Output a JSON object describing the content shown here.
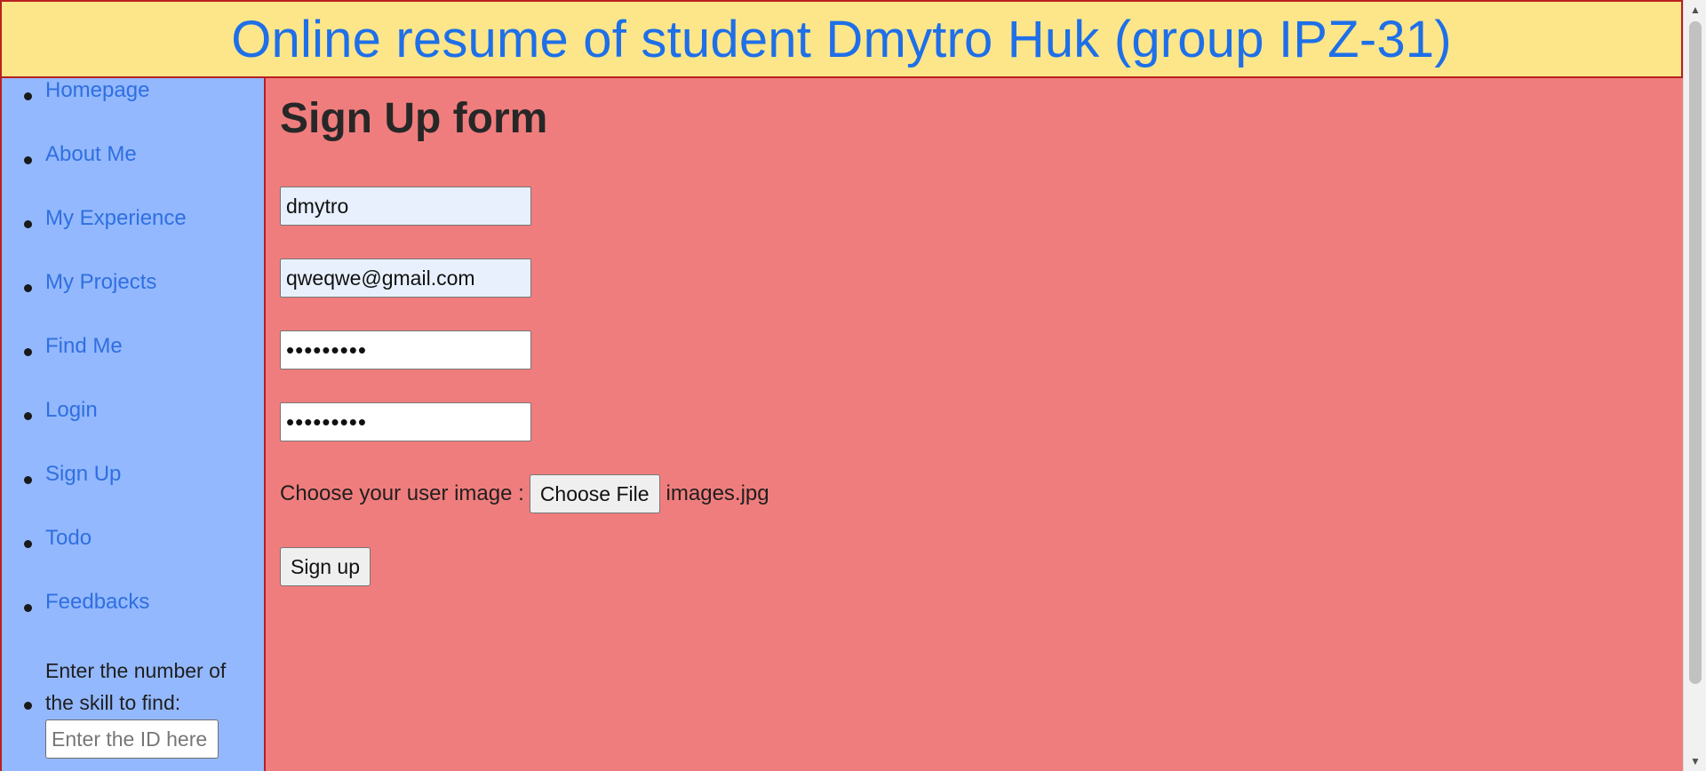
{
  "header": {
    "title": "Online resume of student Dmytro Huk (group IPZ-31)"
  },
  "sidebar": {
    "items": [
      {
        "label": "Homepage"
      },
      {
        "label": "About Me"
      },
      {
        "label": "My Experience"
      },
      {
        "label": "My Projects"
      },
      {
        "label": "Find Me"
      },
      {
        "label": "Login"
      },
      {
        "label": "Sign Up"
      },
      {
        "label": "Todo"
      },
      {
        "label": "Feedbacks"
      }
    ],
    "skill_search": {
      "label": "Enter the number of the skill to find:",
      "placeholder": "Enter the ID here",
      "value": ""
    }
  },
  "form": {
    "title": "Sign Up form",
    "username": "dmytro",
    "email": "qweqwe@gmail.com",
    "password": "•••••••••",
    "confirm_password": "•••••••••",
    "file_label": "Choose your user image :",
    "file_button": "Choose File",
    "file_name": "images.jpg",
    "submit_label": "Sign up"
  },
  "colors": {
    "header_bg": "#fde68a",
    "header_text": "#1e6fe8",
    "sidebar_bg": "#93b8fd",
    "main_bg": "#f07d7d",
    "border": "#b82020",
    "link": "#2f6fe0"
  }
}
